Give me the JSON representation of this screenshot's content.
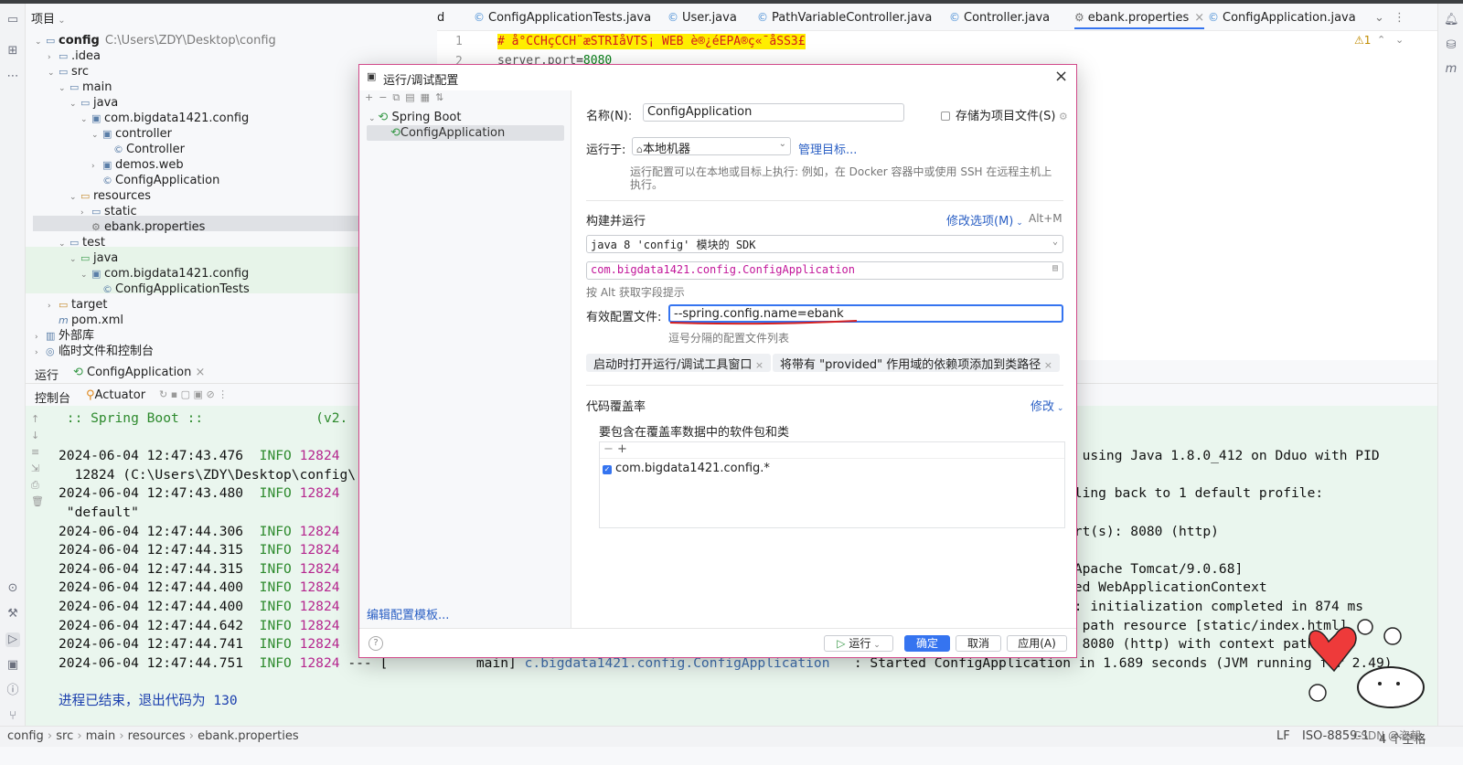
{
  "project": {
    "title": "项目",
    "tree": [
      {
        "label": "config",
        "path": "C:\\Users\\ZDY\\Desktop\\config"
      },
      {
        "label": ".idea"
      },
      {
        "label": "src"
      },
      {
        "label": "main"
      },
      {
        "label": "java"
      },
      {
        "label": "com.bigdata1421.config"
      },
      {
        "label": "controller"
      },
      {
        "label": "Controller"
      },
      {
        "label": "demos.web"
      },
      {
        "label": "ConfigApplication"
      },
      {
        "label": "resources"
      },
      {
        "label": "static"
      },
      {
        "label": "ebank.properties"
      },
      {
        "label": "test"
      },
      {
        "label": "java"
      },
      {
        "label": "com.bigdata1421.config"
      },
      {
        "label": "ConfigApplicationTests"
      },
      {
        "label": "target"
      },
      {
        "label": "pom.xml"
      },
      {
        "label": "外部库"
      },
      {
        "label": "临时文件和控制台"
      }
    ]
  },
  "editor": {
    "tabs": [
      "d",
      "ConfigApplicationTests.java",
      "User.java",
      "PathVariableController.java",
      "Controller.java",
      "ebank.properties",
      "ConfigApplication.java"
    ],
    "active_tab": "ebank.properties",
    "warnings": "1",
    "lines": [
      {
        "num": "1",
        "text": "# å°CCHçCCH¨æSTRIåVTS¡ WEB è®¿éEPA®ç«¯åSS3£"
      },
      {
        "num": "2",
        "key": "server.port",
        "eq": "=",
        "value": "8080"
      }
    ]
  },
  "run": {
    "tab_run": "运行",
    "tab_config": "ConfigApplication",
    "sub_console": "控制台",
    "sub_actuator": "Actuator",
    "console": [
      {
        "t": " :: Spring Boot ::              (v2."
      },
      {
        "t": ""
      },
      {
        "date": "2024-06-04 12:47:43.476",
        "lvl": "INFO",
        "pid": "12824",
        "tail": "n using Java 1.8.0_412 on Dduo with PID"
      },
      {
        "t": "  12824 (C:\\Users\\ZDY\\Desktop\\config\\"
      },
      {
        "date": "2024-06-04 12:47:43.480",
        "lvl": "INFO",
        "pid": "12824",
        "tail": "lling back to 1 default profile:"
      },
      {
        "t": " \"default\""
      },
      {
        "date": "2024-06-04 12:47:44.306",
        "lvl": "INFO",
        "pid": "12824",
        "tail": "ort(s): 8080 (http)"
      },
      {
        "date": "2024-06-04 12:47:44.315",
        "lvl": "INFO",
        "pid": "12824",
        "tail": ""
      },
      {
        "date": "2024-06-04 12:47:44.315",
        "lvl": "INFO",
        "pid": "12824",
        "tail": "[Apache Tomcat/9.0.68]"
      },
      {
        "date": "2024-06-04 12:47:44.400",
        "lvl": "INFO",
        "pid": "12824",
        "tail": "ded WebApplicationContext"
      },
      {
        "date": "2024-06-04 12:47:44.400",
        "lvl": "INFO",
        "pid": "12824",
        "tail": "t: initialization completed in 874 ms"
      },
      {
        "date": "2024-06-04 12:47:44.642",
        "lvl": "INFO",
        "pid": "12824",
        "tail": "s path resource [static/index.html]"
      },
      {
        "date": "2024-06-04 12:47:44.741",
        "lvl": "INFO",
        "pid": "12824",
        "tail": ": 8080 (http) with context path ''"
      },
      {
        "date": "2024-06-04 12:47:44.751",
        "lvl": "INFO",
        "pid": "12824",
        "mid": "--- [           main] ",
        "cls": "c.bigdata1421.config.ConfigApplication",
        "tail": "   : Started ConfigApplication in 1.689 seconds (JVM running for 2.49)"
      },
      {
        "t": ""
      },
      {
        "exit": "进程已结束，退出代码为 130"
      }
    ]
  },
  "status": {
    "breadcrumb": [
      "config",
      "src",
      "main",
      "resources",
      "ebank.properties"
    ],
    "le": "LF",
    "enc": "ISO-8859-1",
    "indent": "4 个空格"
  },
  "dialog": {
    "title": "运行/调试配置",
    "tree_group": "Spring Boot",
    "tree_item": "ConfigApplication",
    "edit_templates": "编辑配置模板...",
    "name_label": "名称(N):",
    "name_value": "ConfigApplication",
    "store_label": "存储为项目文件(S)",
    "run_on_label": "运行于:",
    "run_on_value": "本地机器",
    "manage_targets": "管理目标...",
    "run_on_hint": "运行配置可以在本地或目标上执行: 例如，在 Docker 容器中或使用 SSH 在远程主机上执行。",
    "build_run": "构建并运行",
    "modify_options": "修改选项(M)",
    "modify_shortcut": "Alt+M",
    "sdk": "java 8 'config' 模块的 SDK",
    "main_class": "com.bigdata1421.config.ConfigApplication",
    "alt_hint": "按 Alt 获取字段提示",
    "active_profiles_label": "有效配置文件:",
    "active_profiles_value": "--spring.config.name=ebank",
    "profiles_hint": "逗号分隔的配置文件列表",
    "chip1": "启动时打开运行/调试工具窗口",
    "chip2": "将带有 \"provided\" 作用域的依赖项添加到类路径",
    "coverage": "代码覆盖率",
    "coverage_modify": "修改",
    "coverage_include": "要包含在覆盖率数据中的软件包和类",
    "coverage_pkg": "com.bigdata1421.config.*",
    "run_btn": "运行",
    "ok_btn": "确定",
    "cancel_btn": "取消",
    "apply_btn": "应用(A)"
  },
  "watermark": "CSDN @恣朝",
  "colors": {
    "accent": "#3574f0",
    "dialog_border": "#d14a8a",
    "console_bg": "#eaf6ee",
    "main_class": "#c2169a"
  }
}
